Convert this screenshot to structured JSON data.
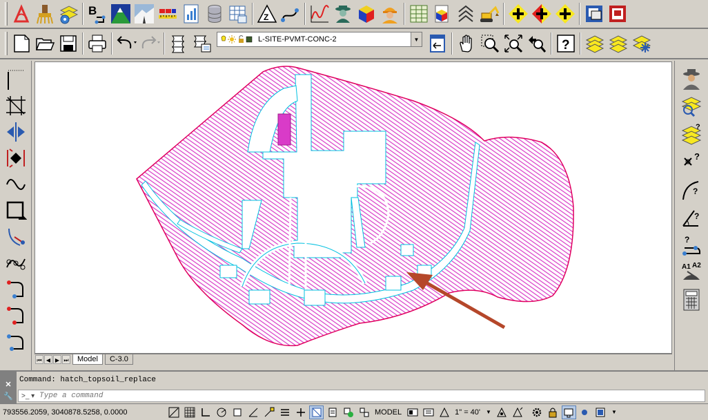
{
  "toolbar_top": {
    "icons": [
      "pdf-icon",
      "cleanup-icon",
      "gear-layers-icon",
      "block-edit-icon",
      "terrain-icon",
      "road-icon",
      "ruler-icon",
      "report-icon",
      "database-icon",
      "spreadsheet-icon",
      "zoom-z-icon",
      "curve-tool-icon",
      "profile-chart-icon",
      "spy-icon",
      "cube-icon",
      "worker-icon",
      "grid-table-icon",
      "cube-red-icon",
      "stack-arrow-icon",
      "excavator-icon",
      "add-yellow-icon",
      "add-red-icon",
      "add-yellow-2-icon",
      "window-cascade-icon",
      "window-red-icon"
    ]
  },
  "toolbar_std": {
    "layer_dropdown": {
      "value": "L-SITE-PVMT-CONC-2"
    }
  },
  "canvas": {
    "hatch_color": "#d93bc8",
    "boundary_color": "#e00060",
    "annotation_arrow_color": "#b5472a"
  },
  "layout_tabs": {
    "model": "Model",
    "layout1": "C-3.0"
  },
  "command": {
    "history": "Command: hatch_topsoil_replace",
    "placeholder": "Type a command"
  },
  "status": {
    "coordinates": "793556.2059, 3040878.5258, 0.0000",
    "space": "MODEL",
    "annotation_scale": "1\" = 40'"
  }
}
